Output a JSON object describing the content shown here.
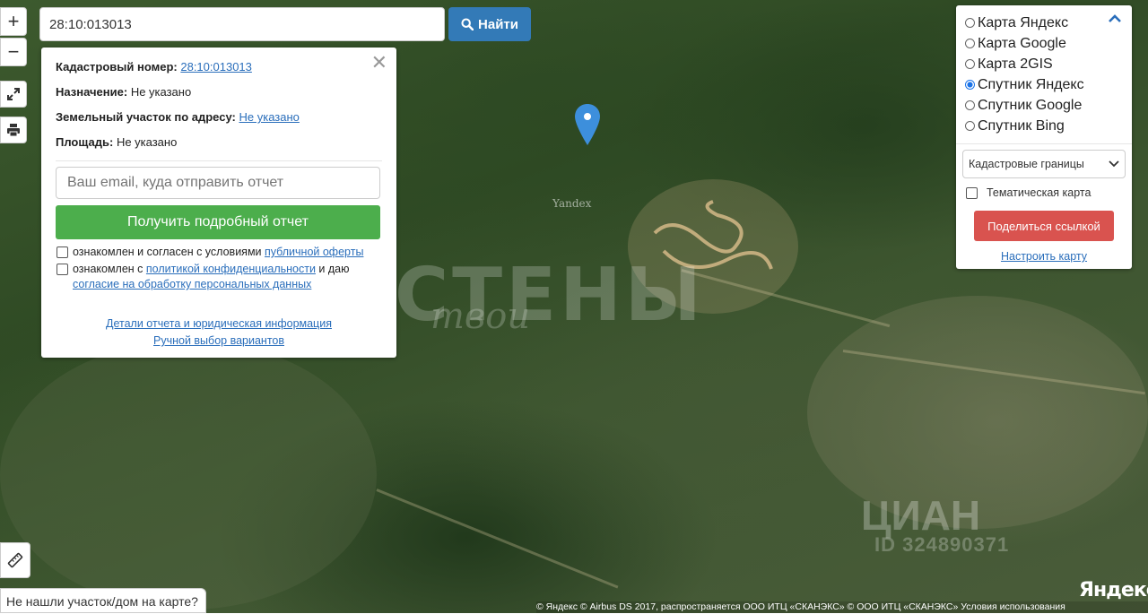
{
  "search": {
    "value": "28:10:013013",
    "button_label": "Найти"
  },
  "zoom": {
    "in_label": "+",
    "out_label": "−"
  },
  "info": {
    "cad_label": "Кадастровый номер:",
    "cad_value": "28:10:013013",
    "purpose_label": "Назначение:",
    "purpose_value": "Не указано",
    "address_label": "Земельный участок по адресу:",
    "address_value": "Не указано",
    "area_label": "Площадь:",
    "area_value": "Не указано",
    "email_placeholder": "Ваш email, куда отправить отчет",
    "report_button": "Получить подробный отчет",
    "check1_text": "ознакомлен и согласен с условиями ",
    "check1_link": "публичной оферты",
    "check2_text": "ознакомлен с ",
    "check2_link": "политикой конфиденциальности",
    "check2_text2": " и даю",
    "check2_link2": "согласие на обработку персональных данных",
    "details_link": "Детали отчета и юридическая информация",
    "manual_link": "Ручной выбор вариантов"
  },
  "layers": {
    "options": [
      {
        "label": "Карта Яндекс",
        "selected": false
      },
      {
        "label": "Карта Google",
        "selected": false
      },
      {
        "label": "Карта 2GIS",
        "selected": false
      },
      {
        "label": "Спутник Яндекс",
        "selected": true
      },
      {
        "label": "Спутник Google",
        "selected": false
      },
      {
        "label": "Спутник Bing",
        "selected": false
      }
    ],
    "select_value": "Кадастровые границы",
    "thematic_label": "Тематическая карта",
    "share_button": "Поделиться ссылкой",
    "configure_link": "Настроить карту"
  },
  "map": {
    "watermark_text": "СТЕНЫ",
    "watermark_script": "твои",
    "yandex_small": "Yandex",
    "cian_text": "ЦИАН",
    "cian_id": "ID 324890371",
    "yandex_logo": "Яндекс",
    "copyright": "© Яндекс  © Airbus DS 2017, распространяется ООО ИТЦ «СКАНЭКС»  © ООО ИТЦ «СКАНЭКС»  Условия использования"
  },
  "bottom": {
    "not_found": "Не нашли участок/дом на карте?"
  },
  "colors": {
    "search_button": "#337ab7",
    "report_button": "#4cae4c",
    "share_button": "#d9534f",
    "link": "#2a6ebb",
    "marker": "#3d8fdc"
  }
}
